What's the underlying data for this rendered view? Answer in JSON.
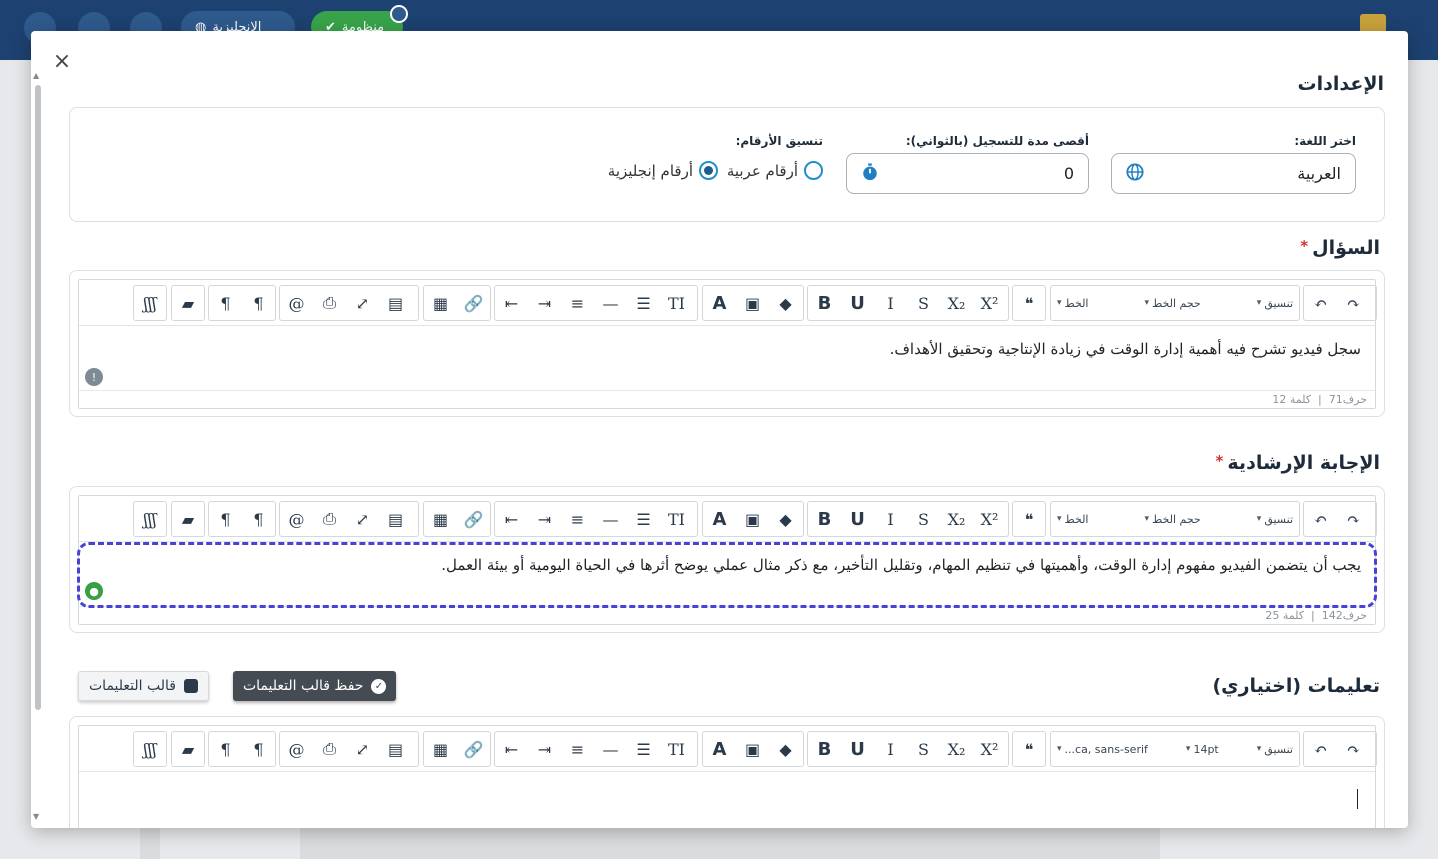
{
  "background": {
    "topbar_buttons": [
      "الإنجليزية",
      "منظومة"
    ]
  },
  "modal": {
    "close_label": "×",
    "settings": {
      "title": "الإعدادات",
      "language": {
        "label": "اختر اللغة:",
        "value": "العربية",
        "icon": "globe-icon"
      },
      "max_duration": {
        "label": "أقصى مدة للتسجيل (بالثواني):",
        "value": "0",
        "icon": "stopwatch-icon"
      },
      "number_format": {
        "label": "تنسيق الأرقام:",
        "options": [
          {
            "label": "أرقام عربية",
            "selected": false
          },
          {
            "label": "أرقام إنجليزية",
            "selected": true
          }
        ]
      }
    },
    "question": {
      "title": "السؤال",
      "required_mark": "*",
      "content": "سجل فيديو تشرح فيه أهمية إدارة الوقت في زيادة الإنتاجية وتحقيق الأهداف.",
      "chars": "حرف71",
      "words": "كلمة 12"
    },
    "guide_answer": {
      "title": "الإجابة الإرشادية",
      "required_mark": "*",
      "content": "يجب أن يتضمن الفيديو مفهوم إدارة الوقت، وأهميتها في تنظيم المهام، وتقليل التأخير، مع ذكر مثال عملي يوضح أثرها في الحياة اليومية أو بيئة العمل.",
      "chars": "حرف142",
      "words": "كلمة 25"
    },
    "instructions": {
      "title": "تعليمات (اختياري)",
      "save_template": "حفظ قالب التعليمات",
      "load_template": "قالب التعليمات",
      "content": ""
    },
    "toolbar": {
      "format": "تنسيق",
      "font_size": "حجم الخط",
      "font": "الخط",
      "font_size_set": "14pt",
      "font_set": "...ca, sans-serif",
      "separator": "|",
      "colors": {
        "accent": "#1d4170",
        "dashed_highlight": "#4a42d6",
        "required": "#d0342c"
      }
    }
  }
}
